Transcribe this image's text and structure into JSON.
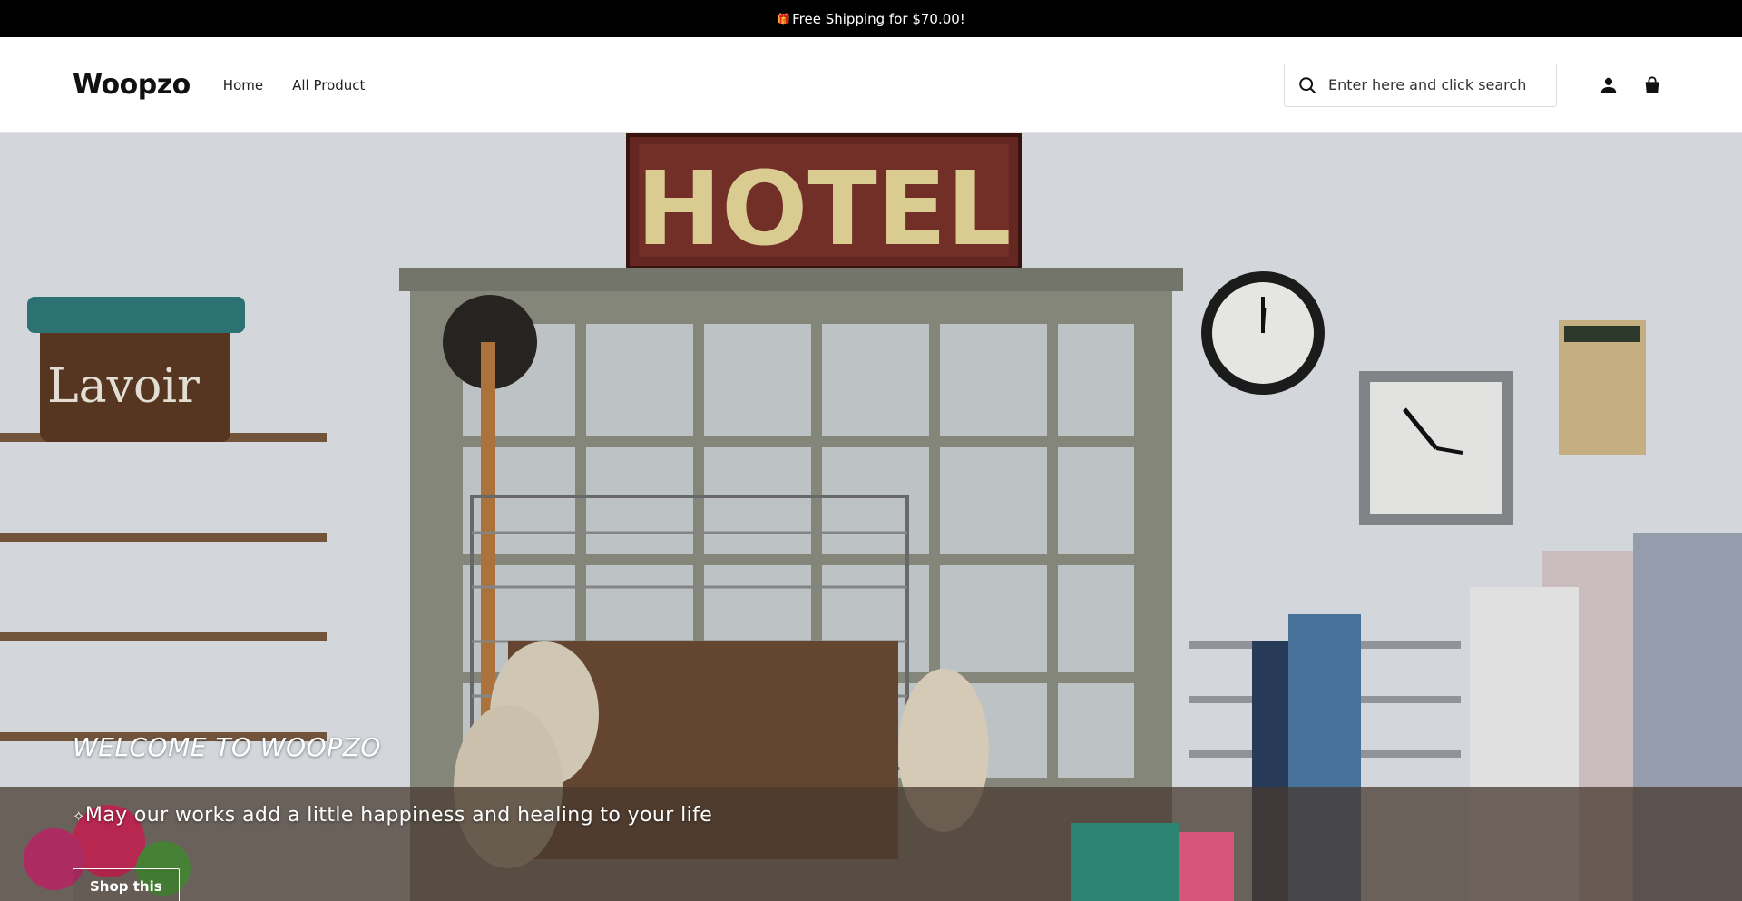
{
  "announcement": {
    "icon": "gift-icon",
    "text": "Free Shipping for $70.00!"
  },
  "header": {
    "logo": "Woopzo",
    "nav": [
      {
        "label": "Home"
      },
      {
        "label": "All Product"
      }
    ],
    "search": {
      "placeholder": "Enter here and click search",
      "value": ""
    },
    "icons": [
      "search-icon",
      "user-icon",
      "shopping-bag-icon"
    ]
  },
  "hero": {
    "sign": "HOTEL",
    "title": "WELCOME TO WOOPZO",
    "subtitle": "May our works add a little happiness and healing to your life",
    "button": "Shop this"
  },
  "colors": {
    "announce_bg": "#000000",
    "header_bg": "#ffffff",
    "accent": "#111111"
  }
}
